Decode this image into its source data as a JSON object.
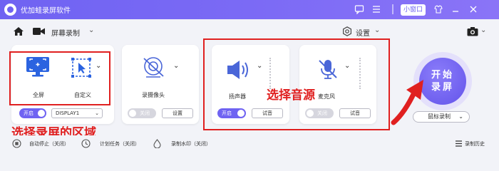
{
  "app": {
    "title": "优加蛙录屏软件",
    "mini_window_label": "小窗口"
  },
  "toolbar": {
    "mode_label": "屏幕录制",
    "settings_label": "设置"
  },
  "region_card": {
    "fullscreen_label": "全屏",
    "custom_label": "自定义",
    "toggle_label": "开启",
    "display_value": "DISPLAY1"
  },
  "camera_card": {
    "label": "录摄像头",
    "toggle_label": "关闭",
    "settings_button": "设置"
  },
  "speaker_card": {
    "label": "扬声器",
    "toggle_label": "开启",
    "test_button": "试音"
  },
  "mic_card": {
    "label": "麦克风",
    "toggle_label": "关闭",
    "test_button": "试音"
  },
  "start": {
    "label_line1": "开始",
    "label_line2": "录屏",
    "mouse_mode": "鼠标录制"
  },
  "annotations": {
    "region": "选择录屏的区域",
    "audio": "选择音源"
  },
  "bottom": {
    "auto_stop": "自动停止（关闭）",
    "schedule": "计划任务（关闭）",
    "watermark": "录制水印（关闭）",
    "history": "录制历史"
  },
  "colors": {
    "accent": "#6f63f2",
    "annotation_red": "#e02020",
    "icon_blue": "#2b63e0"
  }
}
